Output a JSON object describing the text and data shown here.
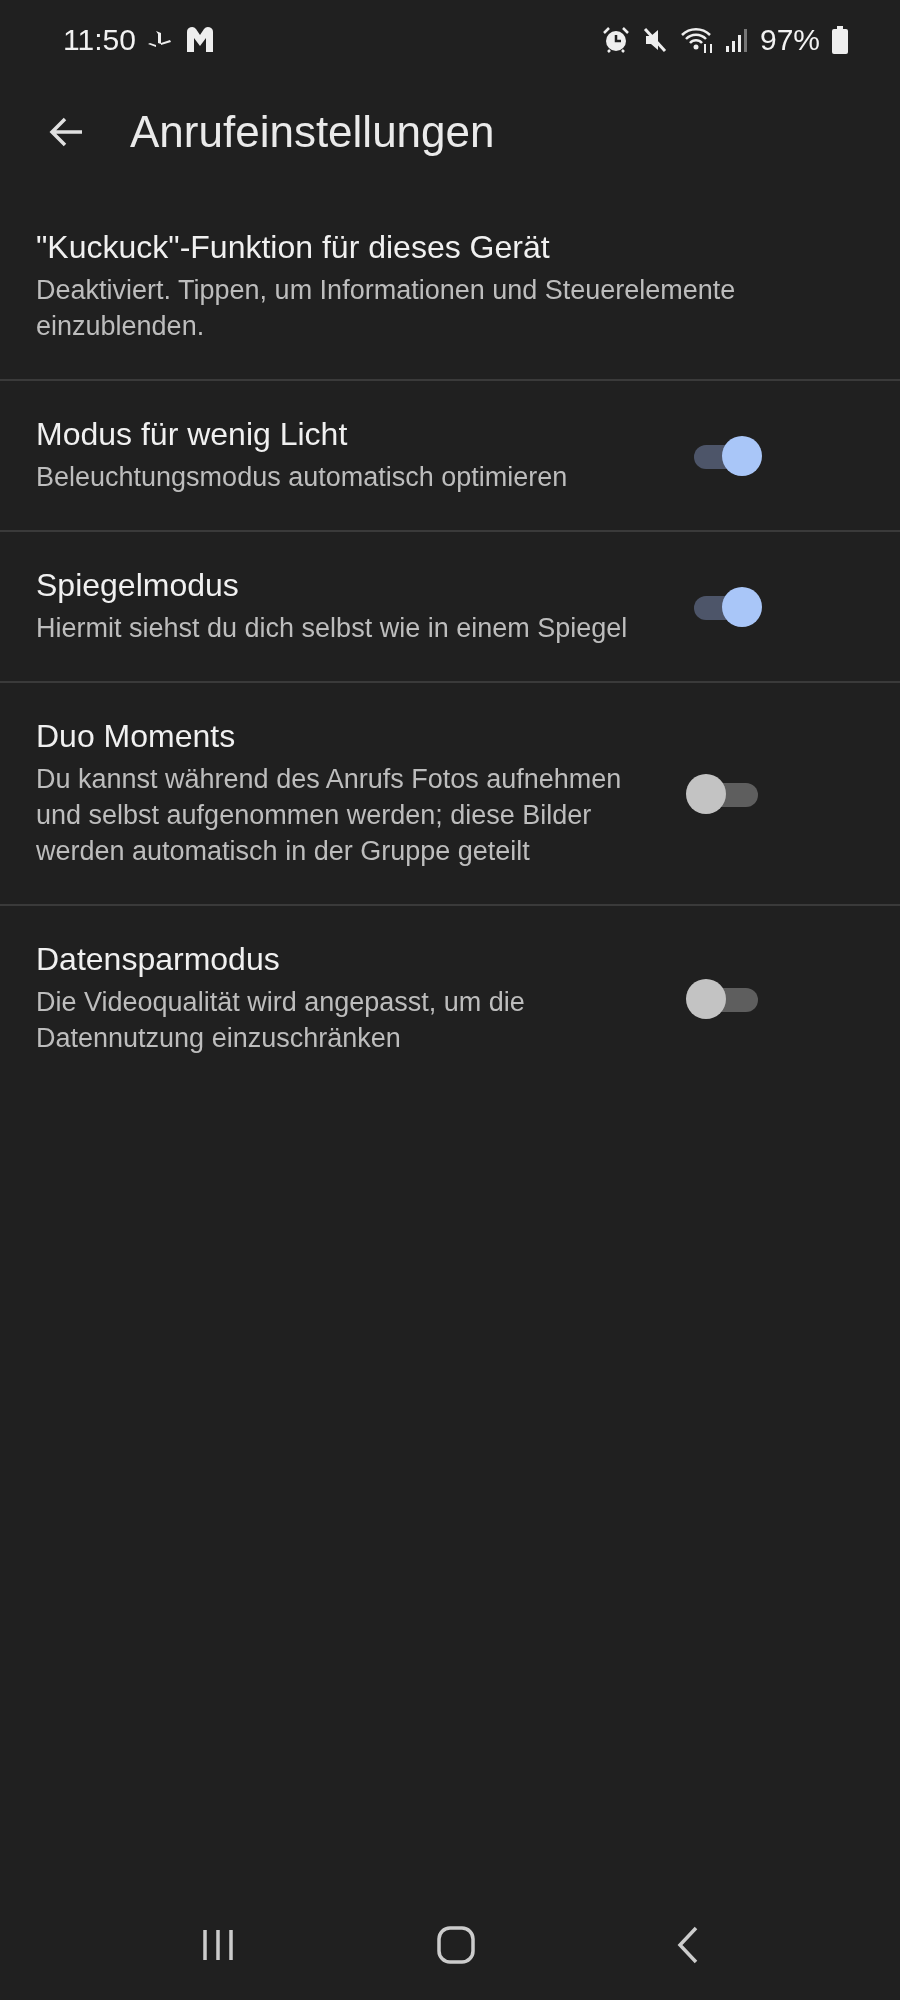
{
  "status_bar": {
    "time": "11:50",
    "battery": "97%"
  },
  "header": {
    "title": "Anrufeinstellungen"
  },
  "settings": [
    {
      "kind": "link",
      "title": "\"Kuckuck\"-Funktion für dieses Gerät",
      "summary": "Deaktiviert. Tippen, um Informationen und Steuerelemente einzublenden."
    },
    {
      "kind": "switch",
      "title": "Modus für wenig Licht",
      "summary": "Beleuchtungsmodus automatisch optimieren",
      "on": true
    },
    {
      "kind": "switch",
      "title": "Spiegelmodus",
      "summary": "Hiermit siehst du dich selbst wie in einem Spiegel",
      "on": true
    },
    {
      "kind": "switch",
      "title": "Duo Moments",
      "summary": "Du kannst während des Anrufs Fotos aufnehmen und selbst aufgenommen werden; diese Bilder werden automatisch in der Gruppe geteilt",
      "on": false
    },
    {
      "kind": "switch",
      "title": "Datensparmodus",
      "summary": "Die Videoqualität wird angepasst, um die Datennutzung einzuschränken",
      "on": false
    }
  ]
}
